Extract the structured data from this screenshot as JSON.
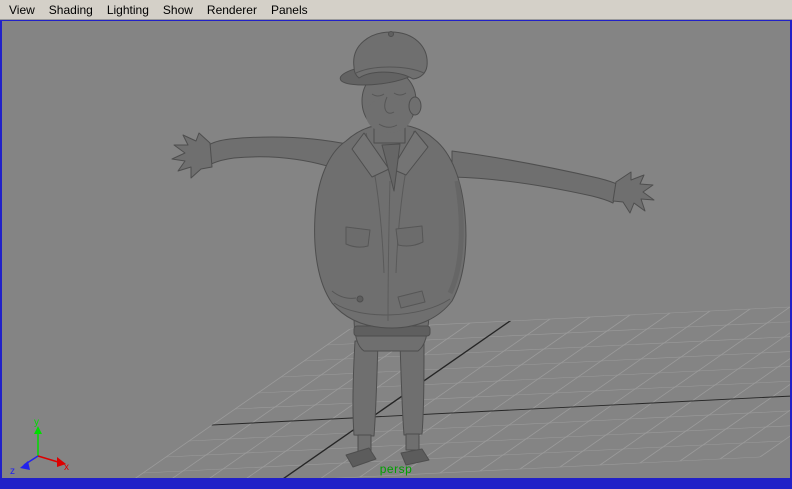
{
  "menubar": {
    "items": [
      "View",
      "Shading",
      "Lighting",
      "Show",
      "Renderer",
      "Panels"
    ]
  },
  "viewport": {
    "camera_label": "persp",
    "axis_indicator": {
      "x_label": "x",
      "y_label": "y",
      "z_label": "z"
    },
    "scene_description": "gray shaded 3D cartoon man wearing a cap and vest, standing in T-pose on a perspective ground grid",
    "colors": {
      "menubar_bg": "#d4d0c8",
      "viewport_bg": "#848484",
      "grid_line": "#9b9b9b",
      "grid_axis": "#252525",
      "model_gray": "#6f6f6f",
      "active_panel_border": "#2121c8",
      "camera_label": "#00a000",
      "axis_x": "#dd0000",
      "axis_y": "#00dd00",
      "axis_z": "#2222ee"
    }
  }
}
